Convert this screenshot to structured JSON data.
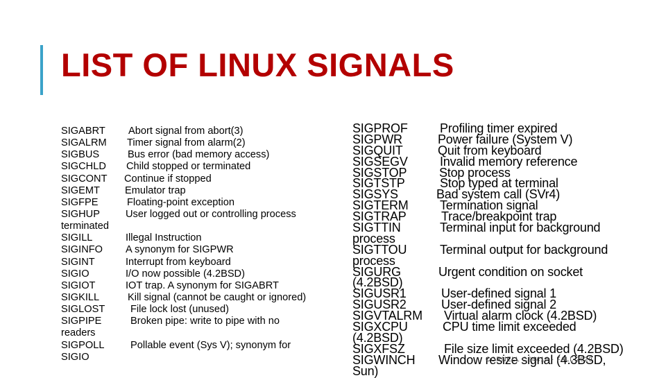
{
  "title": "LIST OF LINUX SIGNALS",
  "colors": {
    "title": "#b30000",
    "accent_bar": "#3ba3c9",
    "text": "#000000"
  },
  "left_column": [
    {
      "signal": "SIGABRT",
      "description": "Abort signal from abort(3)"
    },
    {
      "signal": "SIGALRM",
      "description": "Timer signal from alarm(2)"
    },
    {
      "signal": "SIGBUS",
      "description": "Bus error (bad memory access)"
    },
    {
      "signal": "SIGCHLD",
      "description": "Child stopped or terminated"
    },
    {
      "signal": "SIGCONT",
      "description": "Continue if stopped"
    },
    {
      "signal": "SIGEMT",
      "description": "Emulator trap"
    },
    {
      "signal": "SIGFPE",
      "description": "Floating-point exception"
    },
    {
      "signal": "SIGHUP",
      "description": "User logged out or controlling process"
    },
    {
      "signal": "terminated",
      "description": ""
    },
    {
      "signal": "SIGILL",
      "description": "Illegal Instruction"
    },
    {
      "signal": "SIGINFO",
      "description": "A synonym for SIGPWR"
    },
    {
      "signal": "SIGINT",
      "description": "Interrupt from keyboard"
    },
    {
      "signal": "SIGIO",
      "description": "I/O now possible (4.2BSD)"
    },
    {
      "signal": "SIGIOT",
      "description": "IOT trap. A synonym for SIGABRT"
    },
    {
      "signal": "SIGKILL",
      "description": "Kill signal (cannot be caught or ignored)"
    },
    {
      "signal": "SIGLOST",
      "description": "File lock lost (unused)"
    },
    {
      "signal": "SIGPIPE",
      "description": "Broken pipe: write to pipe with no"
    },
    {
      "signal": "readers",
      "description": ""
    },
    {
      "signal": "SIGPOLL",
      "description": "Pollable event (Sys V); synonym for"
    },
    {
      "signal": "SIGIO",
      "description": ""
    }
  ],
  "right_column": [
    {
      "signal": "SIGPROF",
      "description": "Profiling timer expired"
    },
    {
      "signal": "SIGPWR",
      "description": "Power failure (System V)"
    },
    {
      "signal": "SIGQUIT",
      "description": "Quit from keyboard"
    },
    {
      "signal": "SIGSEGV",
      "description": "Invalid memory reference"
    },
    {
      "signal": "SIGSTOP",
      "description": "Stop process"
    },
    {
      "signal": "SIGTSTP",
      "description": "Stop typed at terminal"
    },
    {
      "signal": "SIGSYS",
      "description": "Bad system call (SVr4)"
    },
    {
      "signal": "SIGTERM",
      "description": "Termination signal"
    },
    {
      "signal": "SIGTRAP",
      "description": "Trace/breakpoint trap"
    },
    {
      "signal": "SIGTTIN",
      "description": "Terminal input for background"
    },
    {
      "signal": "process",
      "description": ""
    },
    {
      "signal": "SIGTTOU",
      "description": "Terminal output for background"
    },
    {
      "signal": "process",
      "description": ""
    },
    {
      "signal": "SIGURG",
      "description": "Urgent condition on socket"
    },
    {
      "signal": "(4.2BSD)",
      "description": ""
    },
    {
      "signal": "SIGUSR1",
      "description": "User-defined signal 1"
    },
    {
      "signal": "SIGUSR2",
      "description": "User-defined signal 2"
    },
    {
      "signal": "SIGVTALRM",
      "description": "Virtual alarm clock (4.2BSD)"
    },
    {
      "signal": "SIGXCPU",
      "description": "CPU time limit exceeded"
    },
    {
      "signal": "(4.2BSD)",
      "description": ""
    },
    {
      "signal": "SIGXFSZ",
      "description": "File size limit exceeded (4.2BSD)"
    },
    {
      "signal": "SIGWINCH",
      "description": "Window resize signal (4.3BSD,"
    },
    {
      "signal": "Sun)",
      "description": ""
    }
  ],
  "footer": "CORNELL CS4414 - FALL 2020"
}
